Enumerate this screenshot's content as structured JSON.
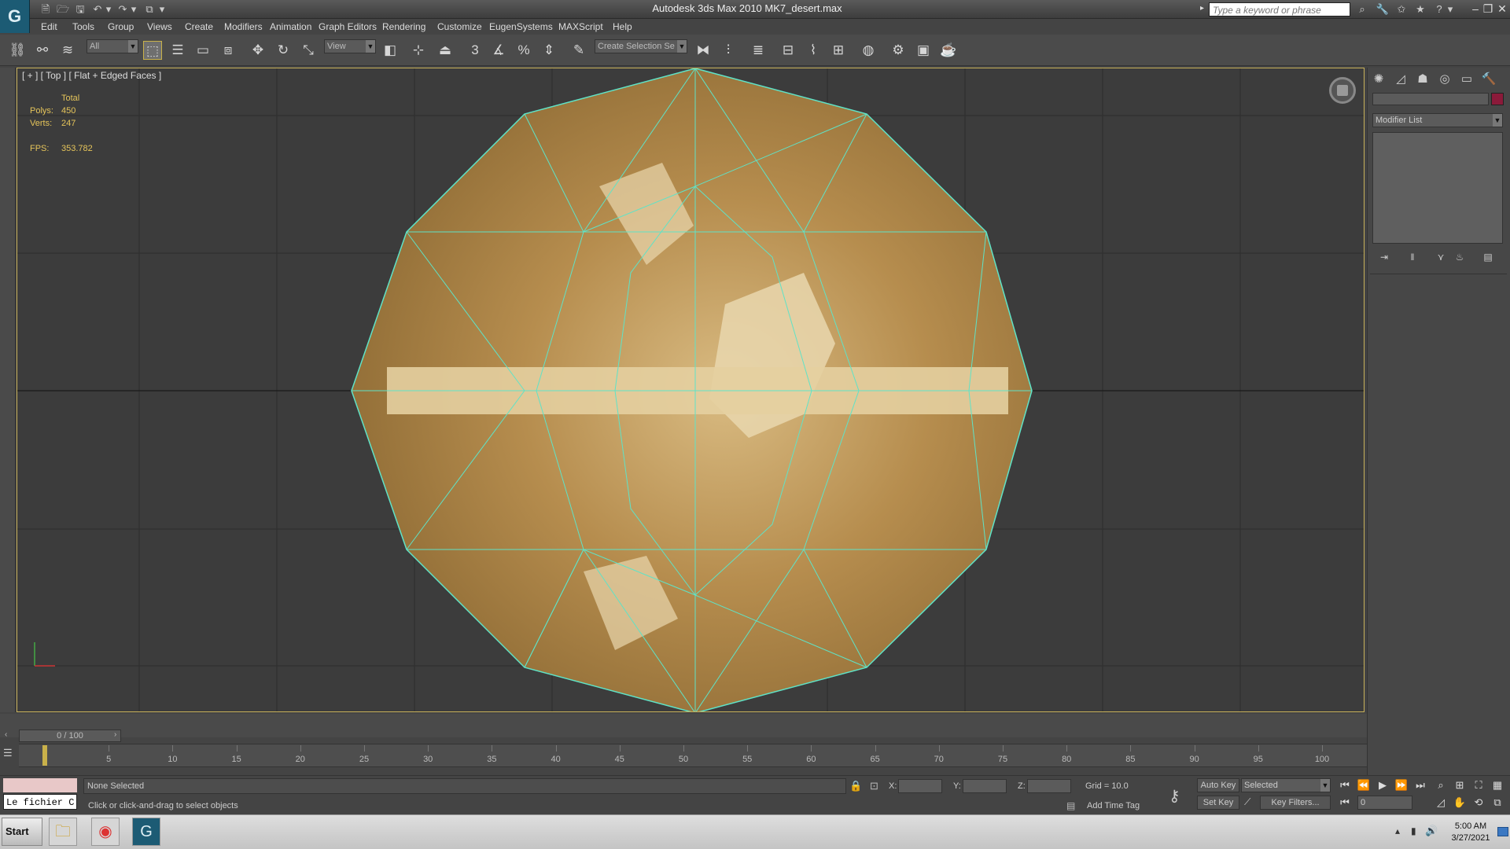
{
  "title": "Autodesk 3ds Max  2010     MK7_desert.max",
  "logo_glyph": "G",
  "quick_access": [
    "🗎",
    "🗁",
    "🖫",
    "↶",
    "▾",
    "↷",
    "▾",
    "⧉",
    "▾"
  ],
  "search": {
    "placeholder": "Type a keyword or phrase"
  },
  "infocenter_icons": [
    "⌕",
    "🔧",
    "✩",
    "★",
    "?",
    "▾"
  ],
  "window_controls": [
    "–",
    "❐",
    "✕"
  ],
  "menu": [
    "Edit",
    "Tools",
    "Group",
    "Views",
    "Create",
    "Modifiers",
    "Animation",
    "Graph Editors",
    "Rendering",
    "Customize",
    "EugenSystems",
    "MAXScript",
    "Help"
  ],
  "toolbar": {
    "selection_filter": "All",
    "ref_coord": "View",
    "named_selection": "Create Selection Se",
    "snap_angle_label": "3",
    "percent_snap": "%"
  },
  "viewport": {
    "label": "[ + ] [ Top ] [ Flat + Edged Faces ]",
    "stats": {
      "total_label": "Total",
      "polys_label": "Polys:",
      "polys_value": "450",
      "verts_label": "Verts:",
      "verts_value": "247",
      "fps_label": "FPS:",
      "fps_value": "353.782"
    },
    "colors": {
      "wire": "#5fe3c7",
      "sand_light": "#e9d7ae",
      "sand_dark": "#8d6a34",
      "grid": "#2d2d2d"
    }
  },
  "command_panel": {
    "tabs": [
      "✺",
      "◿",
      "☗",
      "◎",
      "▭",
      "🔨"
    ],
    "modifier_list": "Modifier List",
    "stack_icons": [
      "⇥",
      "‖",
      "⋎",
      "♨",
      "▤"
    ],
    "object_color": "#8b1a3a"
  },
  "timeline": {
    "slider_label": "0 / 100",
    "ticks": [
      "5",
      "10",
      "15",
      "20",
      "25",
      "30",
      "35",
      "40",
      "45",
      "50",
      "55",
      "60",
      "65",
      "70",
      "75",
      "80",
      "85",
      "90",
      "95",
      "100"
    ]
  },
  "status": {
    "mini_listener_text": "Le fichier C",
    "selection": "None Selected",
    "prompt": "Click or click-and-drag to select objects",
    "x_label": "X:",
    "y_label": "Y:",
    "z_label": "Z:",
    "grid": "Grid = 10.0",
    "add_time_tag": "Add Time Tag",
    "auto_key": "Auto Key",
    "set_key": "Set Key",
    "key_mode": "Selected",
    "key_filters": "Key Filters...",
    "frame": "0"
  },
  "taskbar": {
    "start": "Start",
    "time": "5:00 AM",
    "date": "3/27/2021"
  }
}
